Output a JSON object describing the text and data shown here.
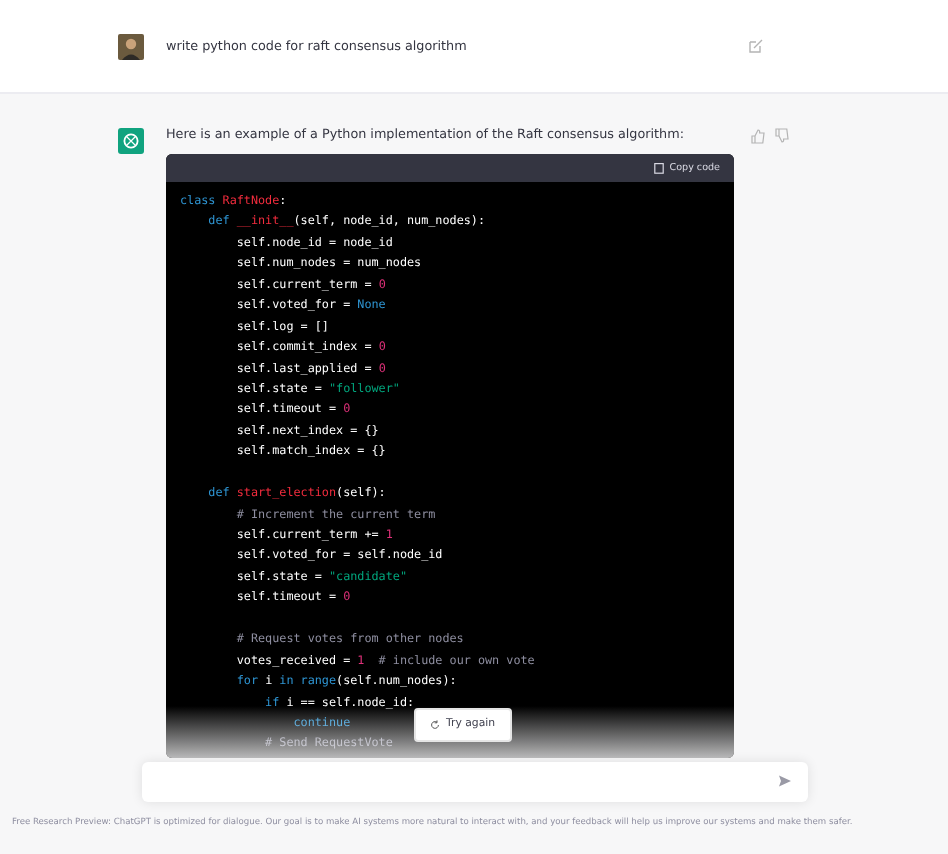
{
  "user_message": {
    "text": "write python code for raft consensus algorithm"
  },
  "assistant_message": {
    "text": "Here is an example of a Python implementation of the Raft consensus algorithm:",
    "code_block": {
      "copy_label": "Copy code",
      "lines": [
        {
          "kind": "code",
          "tokens": [
            {
              "kind": "keyword",
              "s": "class "
            },
            {
              "kind": "title",
              "s": "RaftNode"
            },
            {
              "kind": "plain",
              "s": ":"
            }
          ]
        },
        {
          "kind": "code",
          "tokens": [
            {
              "kind": "keyword",
              "s": "    def "
            },
            {
              "kind": "title",
              "s": "__init__"
            },
            {
              "kind": "plain",
              "s": "(self, node_id, num_nodes):"
            }
          ]
        },
        {
          "kind": "code",
          "tokens": [
            {
              "kind": "plain",
              "s": "        self.node_id = node_id"
            }
          ]
        },
        {
          "kind": "code",
          "tokens": [
            {
              "kind": "plain",
              "s": "        self.num_nodes = num_nodes"
            }
          ]
        },
        {
          "kind": "code",
          "tokens": [
            {
              "kind": "plain",
              "s": "        self.current_term = "
            },
            {
              "kind": "number",
              "s": "0"
            }
          ]
        },
        {
          "kind": "code",
          "tokens": [
            {
              "kind": "plain",
              "s": "        self.voted_for = "
            },
            {
              "kind": "keyword",
              "s": "None"
            }
          ]
        },
        {
          "kind": "code",
          "tokens": [
            {
              "kind": "plain",
              "s": "        self.log = []"
            }
          ]
        },
        {
          "kind": "code",
          "tokens": [
            {
              "kind": "plain",
              "s": "        self.commit_index = "
            },
            {
              "kind": "number",
              "s": "0"
            }
          ]
        },
        {
          "kind": "code",
          "tokens": [
            {
              "kind": "plain",
              "s": "        self.last_applied = "
            },
            {
              "kind": "number",
              "s": "0"
            }
          ]
        },
        {
          "kind": "code",
          "tokens": [
            {
              "kind": "plain",
              "s": "        self.state = "
            },
            {
              "kind": "string",
              "s": "\"follower\""
            }
          ]
        },
        {
          "kind": "code",
          "tokens": [
            {
              "kind": "plain",
              "s": "        self.timeout = "
            },
            {
              "kind": "number",
              "s": "0"
            }
          ]
        },
        {
          "kind": "code",
          "tokens": [
            {
              "kind": "plain",
              "s": "        self.next_index = {}"
            }
          ]
        },
        {
          "kind": "code",
          "tokens": [
            {
              "kind": "plain",
              "s": "        self.match_index = {}"
            }
          ]
        },
        {
          "kind": "blank"
        },
        {
          "kind": "code",
          "tokens": [
            {
              "kind": "keyword",
              "s": "    def "
            },
            {
              "kind": "title",
              "s": "start_election"
            },
            {
              "kind": "plain",
              "s": "(self):"
            }
          ]
        },
        {
          "kind": "code",
          "tokens": [
            {
              "kind": "comment",
              "s": "        # Increment the current term"
            }
          ]
        },
        {
          "kind": "code",
          "tokens": [
            {
              "kind": "plain",
              "s": "        self.current_term += "
            },
            {
              "kind": "number",
              "s": "1"
            }
          ]
        },
        {
          "kind": "code",
          "tokens": [
            {
              "kind": "plain",
              "s": "        self.voted_for = self.node_id"
            }
          ]
        },
        {
          "kind": "code",
          "tokens": [
            {
              "kind": "plain",
              "s": "        self.state = "
            },
            {
              "kind": "string",
              "s": "\"candidate\""
            }
          ]
        },
        {
          "kind": "code",
          "tokens": [
            {
              "kind": "plain",
              "s": "        self.timeout = "
            },
            {
              "kind": "number",
              "s": "0"
            }
          ]
        },
        {
          "kind": "blank"
        },
        {
          "kind": "code",
          "tokens": [
            {
              "kind": "comment",
              "s": "        # Request votes from other nodes"
            }
          ]
        },
        {
          "kind": "code",
          "tokens": [
            {
              "kind": "plain",
              "s": "        votes_received = "
            },
            {
              "kind": "number",
              "s": "1"
            },
            {
              "kind": "comment",
              "s": "  # include our own vote"
            }
          ]
        },
        {
          "kind": "code",
          "tokens": [
            {
              "kind": "keyword",
              "s": "        for "
            },
            {
              "kind": "plain",
              "s": "i "
            },
            {
              "kind": "keyword",
              "s": "in "
            },
            {
              "kind": "builtin",
              "s": "range"
            },
            {
              "kind": "plain",
              "s": "(self.num_nodes):"
            }
          ]
        },
        {
          "kind": "code",
          "tokens": [
            {
              "kind": "keyword",
              "s": "            if "
            },
            {
              "kind": "plain",
              "s": "i == self.node_id:"
            }
          ]
        },
        {
          "kind": "code",
          "tokens": [
            {
              "kind": "keyword",
              "s": "                continue"
            }
          ]
        },
        {
          "kind": "code",
          "tokens": [
            {
              "kind": "comment",
              "s": "            # Send RequestVote"
            }
          ]
        }
      ]
    }
  },
  "try_again_label": "Try again",
  "footer": "Free Research Preview: ChatGPT is optimized for dialogue. Our goal is to make AI systems more natural to interact with, and your feedback will help us improve our systems and make them safer."
}
